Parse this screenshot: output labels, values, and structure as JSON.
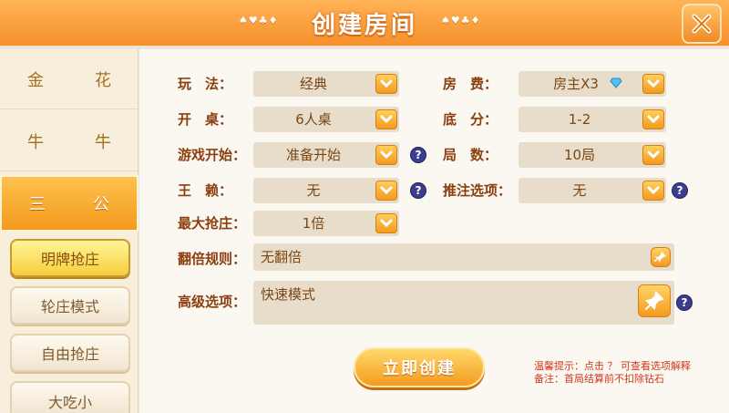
{
  "header": {
    "title": "创建房间",
    "suits_left": "♠♥♣♦",
    "suits_right": "♠♥♣♦"
  },
  "sidebar": {
    "games": [
      {
        "label_a": "金",
        "label_b": "花"
      },
      {
        "label_a": "牛",
        "label_b": "牛"
      },
      {
        "label_a": "三",
        "label_b": "公",
        "active": true
      }
    ],
    "modes": [
      "明牌抢庄",
      "轮庄模式",
      "自由抢庄",
      "大吃小"
    ]
  },
  "form": {
    "play": {
      "label": "玩　法：",
      "value": "经典"
    },
    "fee": {
      "label": "房　费：",
      "value": "房主X3"
    },
    "table": {
      "label": "开　桌：",
      "value": "6人桌"
    },
    "base": {
      "label": "底　分：",
      "value": "1-2"
    },
    "start": {
      "label": "游戏开始：",
      "value": "准备开始"
    },
    "rounds": {
      "label": "局　数：",
      "value": "10局"
    },
    "wild": {
      "label": "王　赖：",
      "value": "无"
    },
    "bet": {
      "label": "推注选项：",
      "value": "无"
    },
    "maxbank": {
      "label": "最大抢庄：",
      "value": "1倍"
    },
    "double": {
      "label": "翻倍规则：",
      "value": "无翻倍"
    },
    "advanced": {
      "label": "高级选项：",
      "value": "快速模式"
    }
  },
  "create_label": "立即创建",
  "tips": {
    "line1": "温馨提示：点击 ？ 可查看选项解释",
    "line2": "备注：首局结算前不扣除钻石"
  },
  "help_symbol": "?"
}
